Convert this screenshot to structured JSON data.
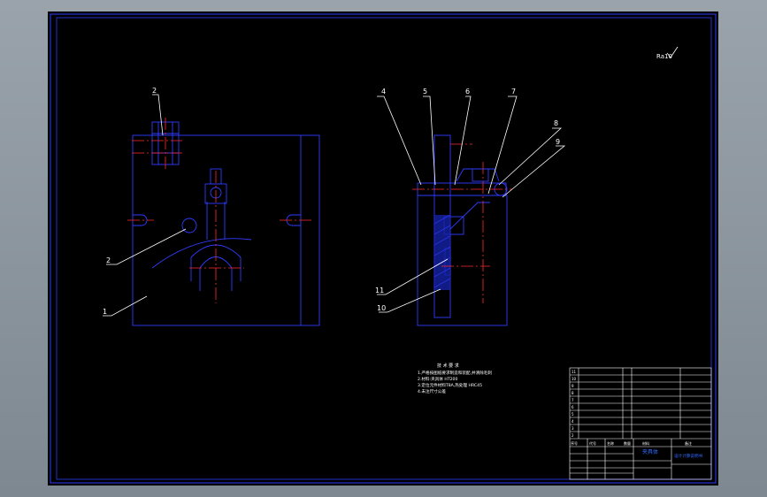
{
  "colors": {
    "outline": "#2f3cff",
    "center": "#ff2a2a",
    "leader": "#ffffff",
    "text": "#ffffff",
    "highlight": "#2f6bff",
    "background": "#000000"
  },
  "corner_note": "Ra10",
  "balloons": {
    "left": [
      "2",
      "2",
      "1"
    ],
    "right": [
      "4",
      "5",
      "6",
      "7",
      "8",
      "9",
      "11",
      "10"
    ]
  },
  "notes": {
    "heading": "技 术 要 求",
    "lines": [
      "1.严格按图纸要求制造和装配,并清除毛刺",
      "2.材料:夹具体 HT200",
      "3.定位元件材料T8A,热处理 HRC45",
      "4.未注尺寸公差"
    ]
  },
  "title_block": {
    "drawing_title": "夹具体",
    "company": "设计计算说明书",
    "part_numbers": [
      "11",
      "10",
      "9",
      "8",
      "7",
      "6",
      "5",
      "4",
      "3",
      "2",
      "1"
    ],
    "header": [
      "序号",
      "代号",
      "名称",
      "数量",
      "材料",
      "备注"
    ]
  }
}
